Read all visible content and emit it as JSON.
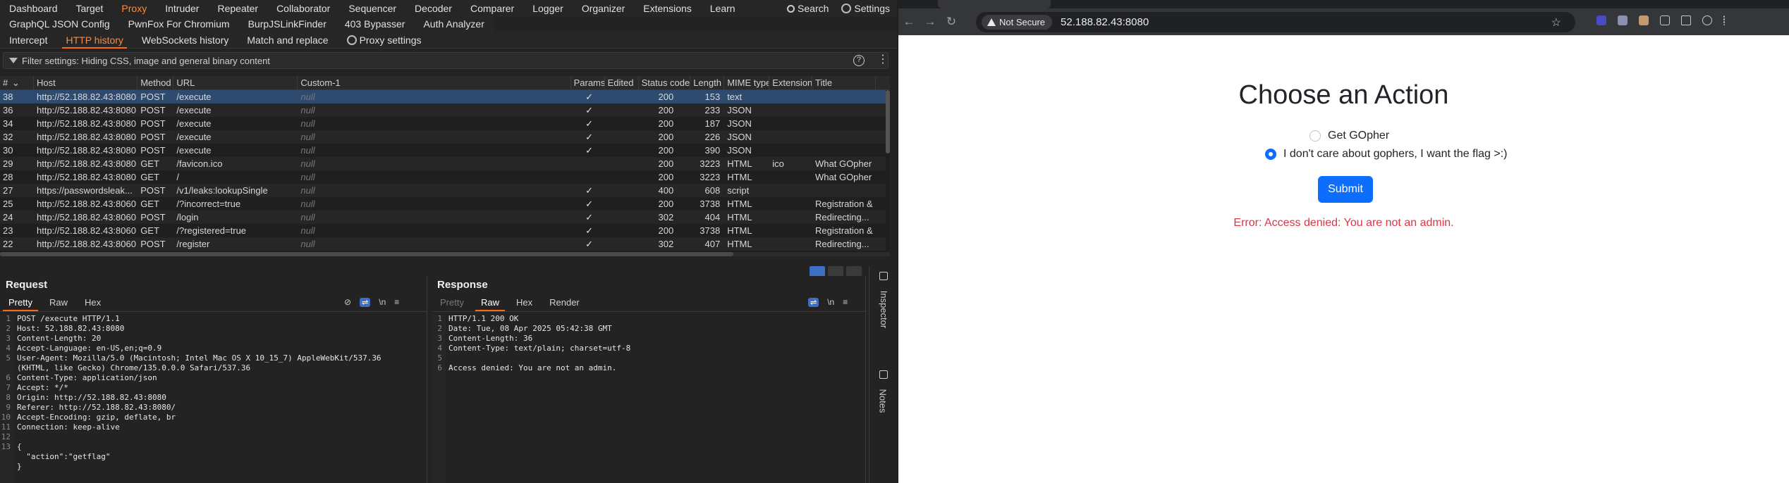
{
  "burp": {
    "top_menu": [
      "Dashboard",
      "Target",
      "Proxy",
      "Intruder",
      "Repeater",
      "Collaborator",
      "Sequencer",
      "Decoder",
      "Comparer",
      "Logger",
      "Organizer",
      "Extensions",
      "Learn"
    ],
    "search_label": "Search",
    "settings_label": "Settings",
    "ext_menu": [
      "GraphQL JSON Config",
      "PwnFox For Chromium",
      "BurpJSLinkFinder",
      "403 Bypasser",
      "Auth Analyzer"
    ],
    "proxy_tabs": [
      "Intercept",
      "HTTP history",
      "WebSockets history",
      "Match and replace"
    ],
    "proxy_settings_label": "Proxy settings",
    "filter_text": "Filter settings: Hiding CSS, image and general binary content",
    "help_glyph": "?",
    "more_glyph": "⋮",
    "columns": [
      "# ",
      "Host",
      "Method",
      "URL",
      "Custom-1",
      "Params",
      "Edited",
      "Status code",
      "Length",
      "MIME type",
      "Extension",
      "Title"
    ],
    "sort_glyph": "⌄",
    "check_glyph": "✓",
    "rows": [
      {
        "id": "38",
        "host": "http://52.188.82.43:8080",
        "method": "POST",
        "url": "/execute",
        "custom": "null",
        "params": "✓",
        "status": "200",
        "length": "153",
        "mime": "text",
        "ext": "",
        "title": ""
      },
      {
        "id": "36",
        "host": "http://52.188.82.43:8080",
        "method": "POST",
        "url": "/execute",
        "custom": "null",
        "params": "✓",
        "status": "200",
        "length": "233",
        "mime": "JSON",
        "ext": "",
        "title": ""
      },
      {
        "id": "34",
        "host": "http://52.188.82.43:8080",
        "method": "POST",
        "url": "/execute",
        "custom": "null",
        "params": "✓",
        "status": "200",
        "length": "187",
        "mime": "JSON",
        "ext": "",
        "title": ""
      },
      {
        "id": "32",
        "host": "http://52.188.82.43:8080",
        "method": "POST",
        "url": "/execute",
        "custom": "null",
        "params": "✓",
        "status": "200",
        "length": "226",
        "mime": "JSON",
        "ext": "",
        "title": ""
      },
      {
        "id": "30",
        "host": "http://52.188.82.43:8080",
        "method": "POST",
        "url": "/execute",
        "custom": "null",
        "params": "✓",
        "status": "200",
        "length": "390",
        "mime": "JSON",
        "ext": "",
        "title": ""
      },
      {
        "id": "29",
        "host": "http://52.188.82.43:8080",
        "method": "GET",
        "url": "/favicon.ico",
        "custom": "null",
        "params": "",
        "status": "200",
        "length": "3223",
        "mime": "HTML",
        "ext": "ico",
        "title": "What GOpher"
      },
      {
        "id": "28",
        "host": "http://52.188.82.43:8080",
        "method": "GET",
        "url": "/",
        "custom": "null",
        "params": "",
        "status": "200",
        "length": "3223",
        "mime": "HTML",
        "ext": "",
        "title": "What GOpher"
      },
      {
        "id": "27",
        "host": "https://passwordsleak...",
        "method": "POST",
        "url": "/v1/leaks:lookupSingle",
        "custom": "null",
        "params": "✓",
        "status": "400",
        "length": "608",
        "mime": "script",
        "ext": "",
        "title": ""
      },
      {
        "id": "25",
        "host": "http://52.188.82.43:8060",
        "method": "GET",
        "url": "/?incorrect=true",
        "custom": "null",
        "params": "✓",
        "status": "200",
        "length": "3738",
        "mime": "HTML",
        "ext": "",
        "title": "Registration &"
      },
      {
        "id": "24",
        "host": "http://52.188.82.43:8060",
        "method": "POST",
        "url": "/login",
        "custom": "null",
        "params": "✓",
        "status": "302",
        "length": "404",
        "mime": "HTML",
        "ext": "",
        "title": "Redirecting..."
      },
      {
        "id": "23",
        "host": "http://52.188.82.43:8060",
        "method": "GET",
        "url": "/?registered=true",
        "custom": "null",
        "params": "✓",
        "status": "200",
        "length": "3738",
        "mime": "HTML",
        "ext": "",
        "title": "Registration &"
      },
      {
        "id": "22",
        "host": "http://52.188.82.43:8060",
        "method": "POST",
        "url": "/register",
        "custom": "null",
        "params": "✓",
        "status": "302",
        "length": "407",
        "mime": "HTML",
        "ext": "",
        "title": "Redirecting..."
      }
    ],
    "request": {
      "title": "Request",
      "tabs": [
        "Pretty",
        "Raw",
        "Hex"
      ],
      "newline_glyph": "\\n",
      "menu_glyph": "≡",
      "lines": [
        {
          "n": "1",
          "t": "POST /execute HTTP/1.1"
        },
        {
          "n": "2",
          "t": "Host: 52.188.82.43:8080"
        },
        {
          "n": "3",
          "t": "Content-Length: 20"
        },
        {
          "n": "4",
          "t": "Accept-Language: en-US,en;q=0.9"
        },
        {
          "n": "5",
          "t": "User-Agent: Mozilla/5.0 (Macintosh; Intel Mac OS X 10_15_7) AppleWebKit/537.36"
        },
        {
          "n": "",
          "t": "(KHTML, like Gecko) Chrome/135.0.0.0 Safari/537.36"
        },
        {
          "n": "6",
          "t": "Content-Type: application/json"
        },
        {
          "n": "7",
          "t": "Accept: */*"
        },
        {
          "n": "8",
          "t": "Origin: http://52.188.82.43:8080"
        },
        {
          "n": "9",
          "t": "Referer: http://52.188.82.43:8080/"
        },
        {
          "n": "10",
          "t": "Accept-Encoding: gzip, deflate, br"
        },
        {
          "n": "11",
          "t": "Connection: keep-alive"
        },
        {
          "n": "12",
          "t": ""
        },
        {
          "n": "13",
          "t": "{"
        },
        {
          "n": "",
          "t": "  \"action\":\"getflag\""
        },
        {
          "n": "",
          "t": "}"
        }
      ]
    },
    "response": {
      "title": "Response",
      "tabs": [
        "Pretty",
        "Raw",
        "Hex",
        "Render"
      ],
      "newline_glyph": "\\n",
      "menu_glyph": "≡",
      "lines": [
        {
          "n": "1",
          "t": "HTTP/1.1 200 OK"
        },
        {
          "n": "2",
          "t": "Date: Tue, 08 Apr 2025 05:42:38 GMT"
        },
        {
          "n": "3",
          "t": "Content-Length: 36"
        },
        {
          "n": "4",
          "t": "Content-Type: text/plain; charset=utf-8"
        },
        {
          "n": "5",
          "t": ""
        },
        {
          "n": "6",
          "t": "Access denied: You are not an admin."
        }
      ]
    },
    "rail": [
      "Inspector",
      "Notes"
    ]
  },
  "browser": {
    "security_label": "Not Secure",
    "url": "52.188.82.43:8080",
    "back_glyph": "←",
    "forward_glyph": "→",
    "reload_glyph": "↻",
    "star_glyph": "☆",
    "page": {
      "title": "Choose an Action",
      "option1": "Get GOpher",
      "option2": "I don't care about gophers, I want the flag >:)",
      "submit": "Submit",
      "error": "Error: Access denied: You are not an admin."
    }
  },
  "colors": {
    "burp_accent": "#ff6a1a",
    "selected_row": "#2e4a6e",
    "bootstrap_primary": "#0d6efd",
    "bootstrap_danger": "#dc3545"
  }
}
